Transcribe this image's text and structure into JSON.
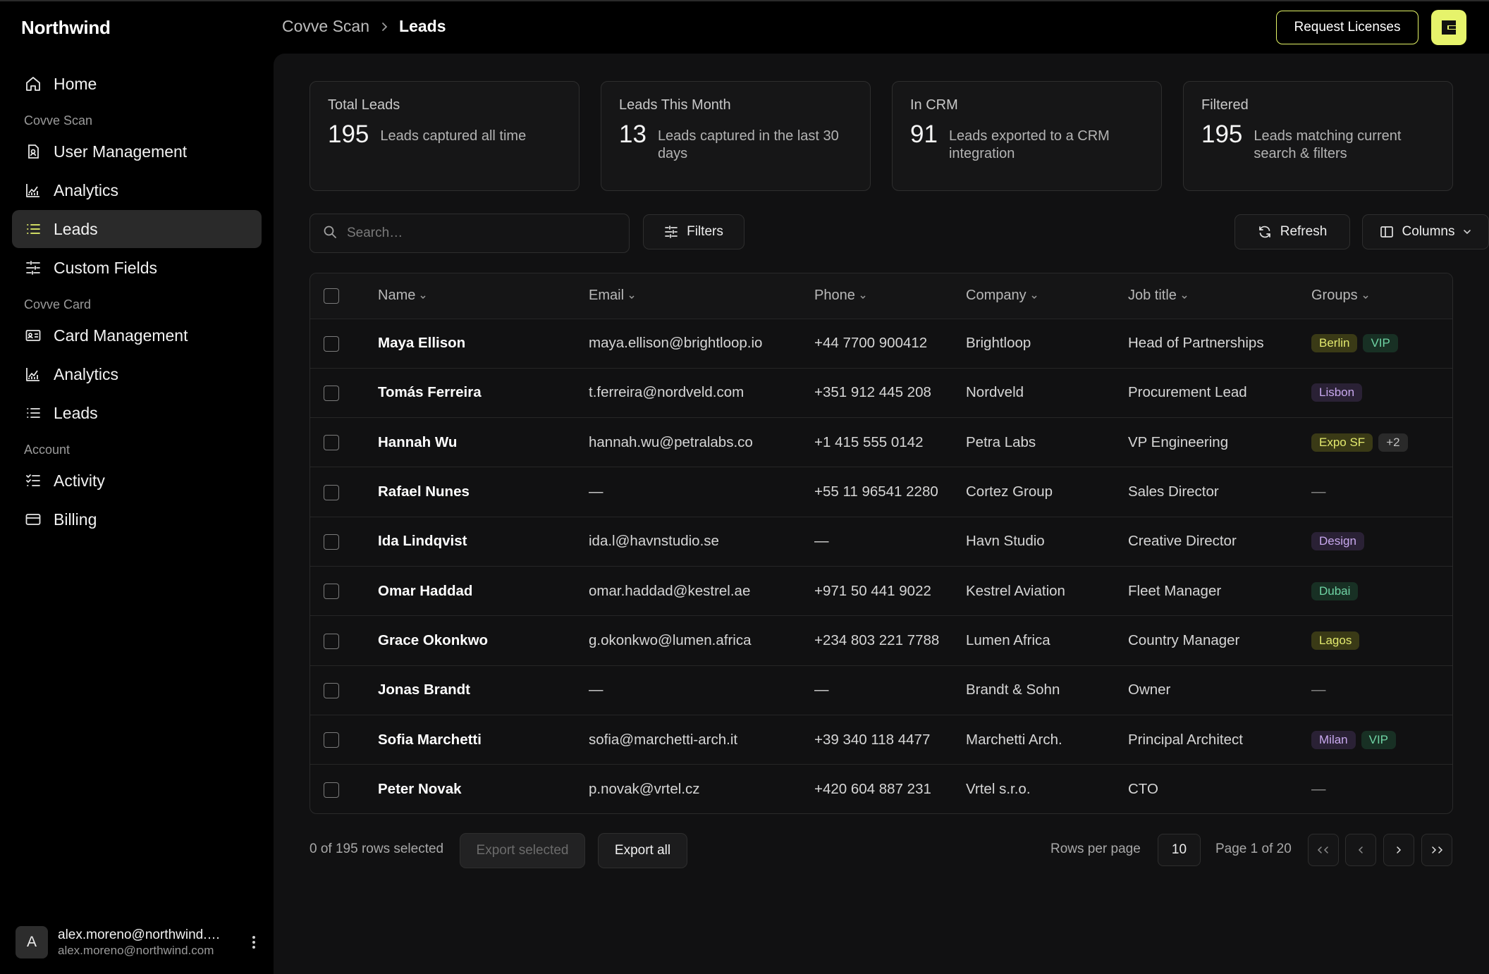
{
  "app": {
    "brand": "Northwind"
  },
  "colors": {
    "accent": "#e6f36b",
    "background": "#000000",
    "panel": "#111112"
  },
  "sidebar": {
    "home": {
      "label": "Home",
      "icon": "home-icon"
    },
    "sections": [
      {
        "title": "Covve Scan",
        "items": [
          {
            "label": "User Management",
            "icon": "user-badge-icon"
          },
          {
            "label": "Analytics",
            "icon": "chart-icon"
          },
          {
            "label": "Leads",
            "icon": "list-icon",
            "active": true
          },
          {
            "label": "Custom Fields",
            "icon": "sliders-icon"
          }
        ]
      },
      {
        "title": "Covve Card",
        "items": [
          {
            "label": "Card Management",
            "icon": "id-card-icon"
          },
          {
            "label": "Analytics",
            "icon": "chart-icon"
          },
          {
            "label": "Leads",
            "icon": "list-icon"
          }
        ]
      },
      {
        "title": "Account",
        "items": [
          {
            "label": "Activity",
            "icon": "checklist-icon"
          },
          {
            "label": "Billing",
            "icon": "credit-card-icon"
          }
        ]
      }
    ],
    "user": {
      "initial": "A",
      "name": "alex.moreno@northwind.…",
      "email": "alex.moreno@northwind.com"
    }
  },
  "header": {
    "breadcrumb": {
      "parent": "Covve Scan",
      "current": "Leads"
    },
    "request_button": "Request Licenses"
  },
  "stats": [
    {
      "title": "Total Leads",
      "value": "195",
      "desc": "Leads captured all time"
    },
    {
      "title": "Leads This Month",
      "value": "13",
      "desc": "Leads captured in the last 30 days"
    },
    {
      "title": "In CRM",
      "value": "91",
      "desc": "Leads exported to a CRM integration"
    },
    {
      "title": "Filtered",
      "value": "195",
      "desc": "Leads matching current search & filters"
    }
  ],
  "toolbar": {
    "search_placeholder": "Search…",
    "filters": "Filters",
    "refresh": "Refresh",
    "columns": "Columns"
  },
  "table": {
    "columns": [
      "Name",
      "Email",
      "Phone",
      "Company",
      "Job title",
      "Groups"
    ],
    "rows": [
      {
        "name": "Maya Ellison",
        "email": "maya.ellison@brightloop.io",
        "phone": "+44 7700 900412",
        "company": "Brightloop",
        "job": "Head of Partnerships",
        "groups": [
          {
            "label": "Berlin",
            "tone": "yellow"
          },
          {
            "label": "VIP",
            "tone": "green"
          }
        ]
      },
      {
        "name": "Tomás Ferreira",
        "email": "t.ferreira@nordveld.com",
        "phone": "+351 912 445 208",
        "company": "Nordveld",
        "job": "Procurement Lead",
        "groups": [
          {
            "label": "Lisbon",
            "tone": "purple"
          }
        ]
      },
      {
        "name": "Hannah Wu",
        "email": "hannah.wu@petralabs.co",
        "phone": "+1 415 555 0142",
        "company": "Petra Labs",
        "job": "VP Engineering",
        "groups": [
          {
            "label": "Expo SF",
            "tone": "yellow"
          },
          {
            "label": "+2",
            "tone": "gray"
          }
        ]
      },
      {
        "name": "Rafael Nunes",
        "email": "—",
        "phone": "+55 11 96541 2280",
        "company": "Cortez Group",
        "job": "Sales Director",
        "groups": []
      },
      {
        "name": "Ida Lindqvist",
        "email": "ida.l@havnstudio.se",
        "phone": "—",
        "company": "Havn Studio",
        "job": "Creative Director",
        "groups": [
          {
            "label": "Design",
            "tone": "purple"
          }
        ]
      },
      {
        "name": "Omar Haddad",
        "email": "omar.haddad@kestrel.ae",
        "phone": "+971 50 441 9022",
        "company": "Kestrel Aviation",
        "job": "Fleet Manager",
        "groups": [
          {
            "label": "Dubai",
            "tone": "green"
          }
        ]
      },
      {
        "name": "Grace Okonkwo",
        "email": "g.okonkwo@lumen.africa",
        "phone": "+234 803 221 7788",
        "company": "Lumen Africa",
        "job": "Country Manager",
        "groups": [
          {
            "label": "Lagos",
            "tone": "yellow"
          }
        ]
      },
      {
        "name": "Jonas Brandt",
        "email": "—",
        "phone": "—",
        "company": "Brandt & Sohn",
        "job": "Owner",
        "groups": []
      },
      {
        "name": "Sofia Marchetti",
        "email": "sofia@marchetti-arch.it",
        "phone": "+39 340 118 4477",
        "company": "Marchetti Arch.",
        "job": "Principal Architect",
        "groups": [
          {
            "label": "Milan",
            "tone": "purple"
          },
          {
            "label": "VIP",
            "tone": "green"
          }
        ]
      },
      {
        "name": "Peter Novak",
        "email": "p.novak@vrtel.cz",
        "phone": "+420 604 887 231",
        "company": "Vrtel s.r.o.",
        "job": "CTO",
        "groups": []
      }
    ],
    "empty_group": "—"
  },
  "footer": {
    "selection": "0 of 195 rows selected",
    "export_selected": "Export selected",
    "export_all": "Export all",
    "rows_per_page_label": "Rows per page",
    "rows_per_page": "10",
    "page_label": "Page 1 of 20"
  }
}
